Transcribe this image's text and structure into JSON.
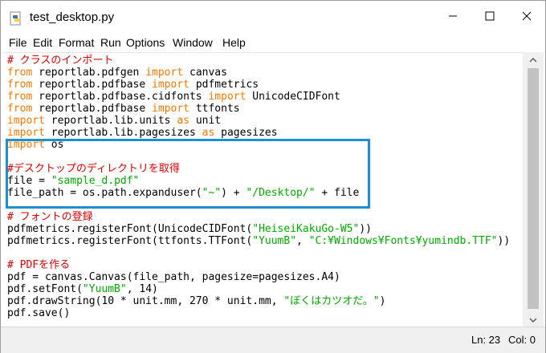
{
  "window": {
    "title": "test_desktop.py"
  },
  "menu": [
    "File",
    "Edit",
    "Format",
    "Run",
    "Options",
    "Window",
    "Help"
  ],
  "code": [
    [
      {
        "t": "# クラスのインポート",
        "c": "cm"
      }
    ],
    [
      {
        "t": "from",
        "c": "kw"
      },
      {
        "t": " reportlab.pdfgen "
      },
      {
        "t": "import",
        "c": "kw"
      },
      {
        "t": " canvas"
      }
    ],
    [
      {
        "t": "from",
        "c": "kw"
      },
      {
        "t": " reportlab.pdfbase "
      },
      {
        "t": "import",
        "c": "kw"
      },
      {
        "t": " pdfmetrics"
      }
    ],
    [
      {
        "t": "from",
        "c": "kw"
      },
      {
        "t": " reportlab.pdfbase.cidfonts "
      },
      {
        "t": "import",
        "c": "kw"
      },
      {
        "t": " UnicodeCIDFont"
      }
    ],
    [
      {
        "t": "from",
        "c": "kw"
      },
      {
        "t": " reportlab.pdfbase "
      },
      {
        "t": "import",
        "c": "kw"
      },
      {
        "t": " ttfonts"
      }
    ],
    [
      {
        "t": "import",
        "c": "kw"
      },
      {
        "t": " reportlab.lib.units "
      },
      {
        "t": "as",
        "c": "kw"
      },
      {
        "t": " unit"
      }
    ],
    [
      {
        "t": "import",
        "c": "kw"
      },
      {
        "t": " reportlab.lib.pagesizes "
      },
      {
        "t": "as",
        "c": "kw"
      },
      {
        "t": " pagesizes"
      }
    ],
    [
      {
        "t": "import",
        "c": "kw"
      },
      {
        "t": " os"
      }
    ],
    [],
    [
      {
        "t": "#デスクトップのディレクトリを取得",
        "c": "cm"
      }
    ],
    [
      {
        "t": "file = "
      },
      {
        "t": "\"sample_d.pdf\"",
        "c": "st"
      }
    ],
    [
      {
        "t": "file_path = os.path.expanduser("
      },
      {
        "t": "\"~\"",
        "c": "st"
      },
      {
        "t": ") + "
      },
      {
        "t": "\"/Desktop/\"",
        "c": "st"
      },
      {
        "t": " + file"
      }
    ],
    [],
    [
      {
        "t": "# フォントの登録",
        "c": "cm"
      }
    ],
    [
      {
        "t": "pdfmetrics.registerFont(UnicodeCIDFont("
      },
      {
        "t": "\"HeiseiKakuGo-W5\"",
        "c": "st"
      },
      {
        "t": "))"
      }
    ],
    [
      {
        "t": "pdfmetrics.registerFont(ttfonts.TTFont("
      },
      {
        "t": "\"YuumB\"",
        "c": "st"
      },
      {
        "t": ", "
      },
      {
        "t": "\"C:¥Windows¥Fonts¥yumindb.TTF\"",
        "c": "st"
      },
      {
        "t": "))"
      }
    ],
    [],
    [
      {
        "t": "# PDFを作る",
        "c": "cm"
      }
    ],
    [
      {
        "t": "pdf = canvas.Canvas(file_path, pagesize=pagesizes.A4)"
      }
    ],
    [
      {
        "t": "pdf.setFont("
      },
      {
        "t": "\"YuumB\"",
        "c": "st"
      },
      {
        "t": ", 14)"
      }
    ],
    [
      {
        "t": "pdf.drawString(10 * unit.mm, 270 * unit.mm, "
      },
      {
        "t": "\"ぼくはカツオだ。\"",
        "c": "st"
      },
      {
        "t": ")"
      }
    ],
    [
      {
        "t": "pdf.save()"
      }
    ]
  ],
  "status": {
    "line": "Ln: 23",
    "col": "Col: 0"
  },
  "colors": {
    "keyword": "#ff7700",
    "comment": "#dd0000",
    "string": "#00aa00",
    "highlight": "#1e90d0"
  },
  "icons": {
    "app": "python-file-icon",
    "minimize": "minimize-icon",
    "maximize": "maximize-icon",
    "close": "close-icon"
  }
}
